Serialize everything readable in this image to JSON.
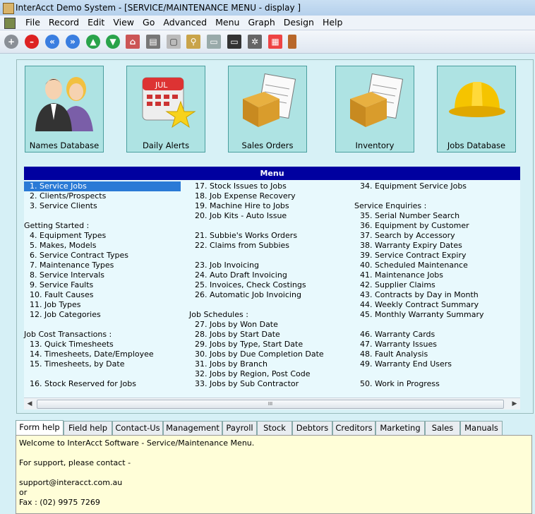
{
  "window": {
    "title": "InterAcct Demo System - [SERVICE/MAINTENANCE MENU - display ]"
  },
  "menubar": [
    "File",
    "Record",
    "Edit",
    "View",
    "Go",
    "Advanced",
    "Menu",
    "Graph",
    "Design",
    "Help"
  ],
  "toolbar": {
    "icons": [
      "plus-icon",
      "stop-icon",
      "first-icon",
      "last-icon",
      "up-icon",
      "down-icon",
      "home-icon",
      "print-icon",
      "page-icon",
      "search-icon",
      "screen-icon",
      "monitor-icon",
      "settings-icon",
      "calendar-icon",
      "exit-door-icon"
    ]
  },
  "tiles": [
    {
      "label": "Names Database",
      "icon": "people-icon"
    },
    {
      "label": "Daily Alerts",
      "icon": "calendar-star-icon"
    },
    {
      "label": "Sales Orders",
      "icon": "box-document-icon"
    },
    {
      "label": "Inventory",
      "icon": "box-document-icon"
    },
    {
      "label": "Jobs Database",
      "icon": "hardhat-icon"
    }
  ],
  "menu": {
    "header": "Menu",
    "col1": [
      {
        "t": "1. Service Jobs",
        "item": true,
        "sel": true
      },
      {
        "t": "2. Clients/Prospects",
        "item": true
      },
      {
        "t": "3. Service Clients",
        "item": true
      },
      {
        "t": "",
        "blank": true
      },
      {
        "t": "Getting Started :"
      },
      {
        "t": "4. Equipment Types",
        "item": true
      },
      {
        "t": "5. Makes, Models",
        "item": true
      },
      {
        "t": "6. Service Contract Types",
        "item": true
      },
      {
        "t": "7. Maintenance Types",
        "item": true
      },
      {
        "t": "8. Service Intervals",
        "item": true
      },
      {
        "t": "9. Service Faults",
        "item": true
      },
      {
        "t": "10. Fault Causes",
        "item": true
      },
      {
        "t": "11. Job Types",
        "item": true
      },
      {
        "t": "12. Job Categories",
        "item": true
      },
      {
        "t": "",
        "blank": true
      },
      {
        "t": "Job Cost Transactions :"
      },
      {
        "t": "13. Quick Timesheets",
        "item": true
      },
      {
        "t": "14. Timesheets, Date/Employee",
        "item": true
      },
      {
        "t": "15. Timesheets, by Date",
        "item": true
      },
      {
        "t": "",
        "blank": true
      },
      {
        "t": "16. Stock Reserved for Jobs",
        "item": true
      }
    ],
    "col2": [
      {
        "t": "17. Stock Issues to Jobs",
        "item": true
      },
      {
        "t": "18. Job Expense Recovery",
        "item": true
      },
      {
        "t": "19. Machine Hire to Jobs",
        "item": true
      },
      {
        "t": "20. Job Kits - Auto Issue",
        "item": true
      },
      {
        "t": "",
        "blank": true
      },
      {
        "t": "21. Subbie's Works Orders",
        "item": true
      },
      {
        "t": "22. Claims from Subbies",
        "item": true
      },
      {
        "t": "",
        "blank": true
      },
      {
        "t": "23. Job Invoicing",
        "item": true
      },
      {
        "t": "24. Auto Draft Invoicing",
        "item": true
      },
      {
        "t": "25. Invoices, Check Costings",
        "item": true
      },
      {
        "t": "26. Automatic Job Invoicing",
        "item": true
      },
      {
        "t": "",
        "blank": true
      },
      {
        "t": "Job Schedules :",
        "head": true
      },
      {
        "t": "27. Jobs by Won Date",
        "item": true
      },
      {
        "t": "28. Jobs by Start Date",
        "item": true
      },
      {
        "t": "29. Jobs by Type, Start Date",
        "item": true
      },
      {
        "t": "30. Jobs by Due Completion Date",
        "item": true
      },
      {
        "t": "31. Jobs by Branch",
        "item": true
      },
      {
        "t": "32. Jobs by Region, Post Code",
        "item": true
      },
      {
        "t": "33. Jobs by Sub Contractor",
        "item": true
      }
    ],
    "col3": [
      {
        "t": "34. Equipment Service Jobs",
        "item": true
      },
      {
        "t": "",
        "blank": true
      },
      {
        "t": "Service Enquiries :",
        "head": true
      },
      {
        "t": "35. Serial Number Search",
        "item": true
      },
      {
        "t": "36. Equipment by Customer",
        "item": true
      },
      {
        "t": "37. Search by Accessory",
        "item": true
      },
      {
        "t": "38. Warranty Expiry Dates",
        "item": true
      },
      {
        "t": "39. Service Contract Expiry",
        "item": true
      },
      {
        "t": "40. Scheduled Maintenance",
        "item": true
      },
      {
        "t": "41. Maintenance Jobs",
        "item": true
      },
      {
        "t": "42. Supplier Claims",
        "item": true
      },
      {
        "t": "43. Contracts by Day in Month",
        "item": true
      },
      {
        "t": "44. Weekly Contract Summary",
        "item": true
      },
      {
        "t": "45. Monthly Warranty Summary",
        "item": true
      },
      {
        "t": "",
        "blank": true
      },
      {
        "t": "46. Warranty Cards",
        "item": true
      },
      {
        "t": "47. Warranty Issues",
        "item": true
      },
      {
        "t": "48. Fault Analysis",
        "item": true
      },
      {
        "t": "49. Warranty End Users",
        "item": true
      },
      {
        "t": "",
        "blank": true
      },
      {
        "t": "50. Work in Progress",
        "item": true
      }
    ],
    "scroll_thumb": "III"
  },
  "tabs": [
    "Form help",
    "Field help",
    "Contact-Us",
    "Management",
    "Payroll",
    "Stock",
    "Debtors",
    "Creditors",
    "Marketing",
    "Sales",
    "Manuals"
  ],
  "help": {
    "line1": "Welcome to InterAcct Software - Service/Maintenance Menu.",
    "line2": "For support, please contact -",
    "line3": "support@interacct.com.au",
    "line4": "or",
    "line5": "Fax : (02) 9975 7269"
  }
}
